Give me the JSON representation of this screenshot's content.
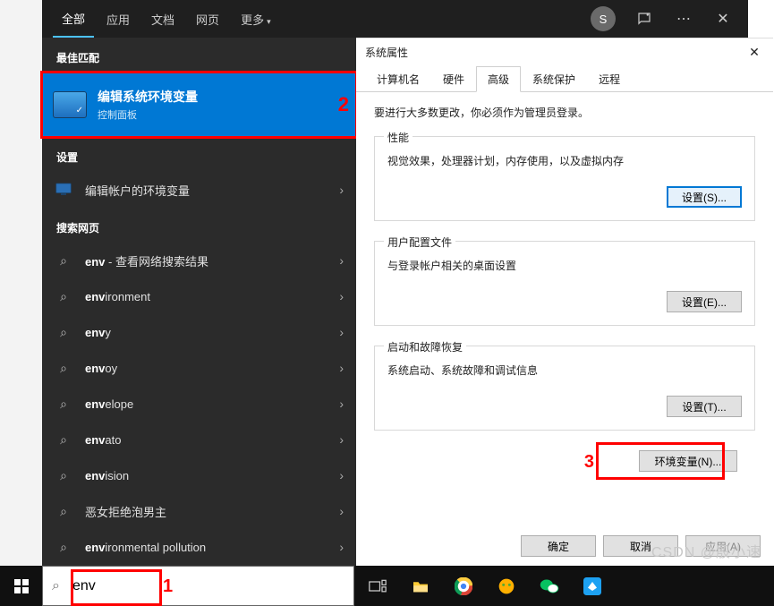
{
  "search": {
    "tabs": {
      "all": "全部",
      "apps": "应用",
      "docs": "文档",
      "web": "网页",
      "more": "更多"
    },
    "avatar_initial": "S",
    "best_header": "最佳匹配",
    "best": {
      "title": "编辑系统环境变量",
      "sub": "控制面板"
    },
    "settings_header": "设置",
    "settings_item": "编辑帐户的环境变量",
    "websearch_header": "搜索网页",
    "web_suffix": " - 查看网络搜索结果",
    "terms": {
      "t0": "env",
      "t1_pre": "env",
      "t1_suf": "ironment",
      "t2_pre": "env",
      "t2_suf": "y",
      "t3_pre": "env",
      "t3_suf": "oy",
      "t4_pre": "env",
      "t4_suf": "elope",
      "t5_pre": "env",
      "t5_suf": "ato",
      "t6_pre": "env",
      "t6_suf": "ision",
      "t7_full": "恶女拒绝泡男主",
      "t8_pre": "env",
      "t8_suf": "ironmental pollution"
    }
  },
  "dialog": {
    "title": "系统属性",
    "tabs": {
      "computer": "计算机名",
      "hardware": "硬件",
      "advanced": "高级",
      "protect": "系统保护",
      "remote": "远程"
    },
    "info": "要进行大多数更改，你必须作为管理员登录。",
    "perf": {
      "label": "性能",
      "desc": "视觉效果，处理器计划，内存使用，以及虚拟内存",
      "btn": "设置(S)..."
    },
    "profile": {
      "label": "用户配置文件",
      "desc": "与登录帐户相关的桌面设置",
      "btn": "设置(E)..."
    },
    "startup": {
      "label": "启动和故障恢复",
      "desc": "系统启动、系统故障和调试信息",
      "btn": "设置(T)..."
    },
    "env_btn": "环境变量(N)...",
    "ok": "确定",
    "cancel": "取消",
    "apply": "应用(A)"
  },
  "taskbar": {
    "search_value": "env"
  },
  "annotations": {
    "n1": "1",
    "n2": "2",
    "n3": "3"
  },
  "watermark": "CSDN @殷小速"
}
